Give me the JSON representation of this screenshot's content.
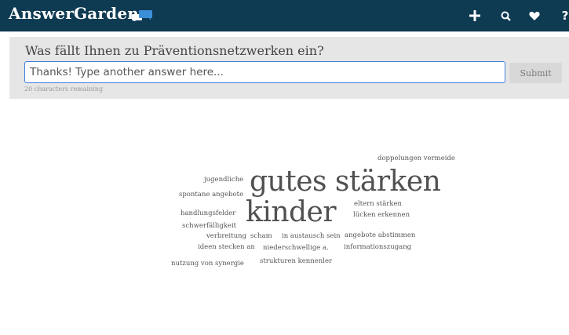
{
  "header": {
    "brand": "AnswerGarden",
    "icons": [
      "plus-icon",
      "search-icon",
      "heart-icon",
      "help-icon"
    ],
    "help_glyph": "?"
  },
  "question": {
    "text": "Was fällt Ihnen zu Präventionsnetzwerken ein?",
    "input_placeholder": "Thanks! Type another answer here...",
    "input_value": "",
    "submit_label": "Submit",
    "remaining": "20 characters remaining"
  },
  "colors": {
    "header_bg": "#0e3a52",
    "input_border": "#3d7ee0",
    "panel_bg": "#e6e6e6",
    "word_color": "#555555"
  },
  "word_cloud": [
    "doppelungen vermeide",
    "jugendliche",
    "gutes stärken",
    "spontane angebote",
    "eltern stärken",
    "kinder",
    "handlungsfelder",
    "lücken erkennen",
    "schwerfälligkeit",
    "verbreitung",
    "scham",
    "in austausch sein",
    "angebote abstimmen",
    "ideen stecken an",
    "niederschwellige a.",
    "informationszugang",
    "nutzung von synergie",
    "strukturen kennenler"
  ]
}
